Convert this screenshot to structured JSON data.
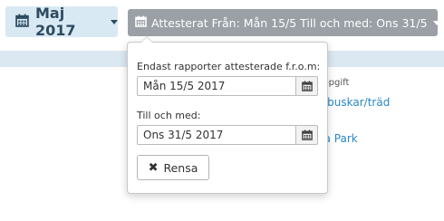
{
  "header": {
    "month_label": "Maj 2017",
    "attest_filter_label": "Attesterat Från: Mån 15/5 Till och med: Ons 31/5"
  },
  "background": {
    "column_header": "uppgift",
    "row_links": [
      "a buskar/träd",
      "na Park"
    ]
  },
  "filter_dropdown": {
    "from_label": "Endast rapporter attesterade f.r.o.m:",
    "from_value": "Mån 15/5 2017",
    "to_label": "Till och med:",
    "to_value": "Ons 31/5 2017",
    "clear_label": "Rensa"
  },
  "icons": {
    "calendar": "calendar-icon",
    "caret": "caret-down-icon",
    "clear": "times-icon"
  },
  "colors": {
    "month_button_bg": "#d9e9f4",
    "month_button_text": "#2d4b60",
    "filter_button_bg": "#9aa0a6",
    "link": "#2a87c7",
    "band": "#dbe8f2"
  }
}
